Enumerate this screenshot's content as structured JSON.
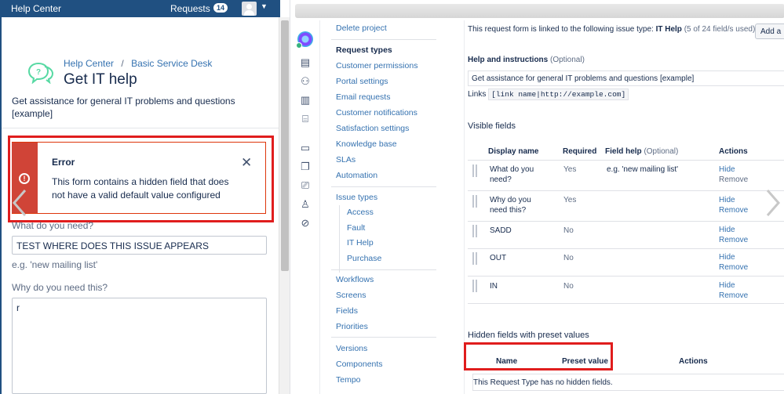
{
  "help_center": {
    "topbar": {
      "title": "Help Center",
      "requests_label": "Requests",
      "requests_count": "14"
    },
    "breadcrumb": {
      "root": "Help Center",
      "separator": "/",
      "desk": "Basic Service Desk"
    },
    "page_title": "Get IT help",
    "description": "Get assistance for general IT problems and questions [example]",
    "error": {
      "title": "Error",
      "message": "This form contains a hidden field that does not have a valid default value configured",
      "close_symbol": "✕",
      "icon": "alert-circle-icon"
    },
    "fields": [
      {
        "label": "What do you need?",
        "value": "TEST WHERE DOES THIS ISSUE APPEARS",
        "hint": "e.g. 'new mailing list'"
      },
      {
        "label": "Why do you need this?",
        "value": "r"
      }
    ],
    "colors": {
      "brand": "#205081",
      "error": "#d04437",
      "highlight": "#e01d1d"
    }
  },
  "project_settings": {
    "sidebar_icons": [
      "project-avatar-icon",
      "queues-icon",
      "customers-icon",
      "reports-icon",
      "raise-request-icon",
      "knowledge-icon",
      "channels-icon",
      "invite-team-icon",
      "add-customer-icon",
      "compass-icon",
      "settings-icon"
    ],
    "menu": {
      "delete_project": "Delete project",
      "request_types": "Request types",
      "customer_permissions": "Customer permissions",
      "portal_settings": "Portal settings",
      "email_requests": "Email requests",
      "customer_notifications": "Customer notifications",
      "satisfaction_settings": "Satisfaction settings",
      "knowledge_base": "Knowledge base",
      "slas": "SLAs",
      "automation": "Automation",
      "issue_types": "Issue types",
      "issue_type_items": [
        "Access",
        "Fault",
        "IT Help",
        "Purchase"
      ],
      "workflows": "Workflows",
      "screens": "Screens",
      "fields": "Fields",
      "priorities": "Priorities",
      "versions": "Versions",
      "components": "Components",
      "tempo": "Tempo"
    },
    "content": {
      "linked_text": "This request form is linked to the following issue type:",
      "issue_type": "IT Help",
      "field_count": "(5 of 24 field/s used)",
      "add_button": "Add a",
      "help_heading": "Help and instructions",
      "optional": "(Optional)",
      "help_value": "Get assistance for general IT problems and questions [example]",
      "links_label": "Links",
      "links_code": "[link name|http://example.com]",
      "visible_fields_heading": "Visible fields",
      "columns": {
        "display_name": "Display name",
        "required": "Required",
        "field_help": "Field help",
        "field_help_optional": "(Optional)",
        "actions": "Actions"
      },
      "rows": [
        {
          "name": "What do you need?",
          "required": "Yes",
          "help": "e.g. 'new mailing list'",
          "hide": "Hide",
          "remove": "Remove"
        },
        {
          "name": "Why do you need this?",
          "required": "Yes",
          "help": "",
          "hide": "Hide",
          "remove": "Remove"
        },
        {
          "name": "SADD",
          "required": "No",
          "help": "",
          "hide": "Hide",
          "remove": "Remove"
        },
        {
          "name": "OUT",
          "required": "No",
          "help": "",
          "hide": "Hide",
          "remove": "Remove"
        },
        {
          "name": "IN",
          "required": "No",
          "help": "",
          "hide": "Hide",
          "remove": "Remove"
        }
      ],
      "hidden_heading": "Hidden fields with preset values",
      "hidden_columns": {
        "name": "Name",
        "preset": "Preset value",
        "actions": "Actions"
      },
      "hidden_note": "This Request Type has no hidden fields."
    }
  }
}
